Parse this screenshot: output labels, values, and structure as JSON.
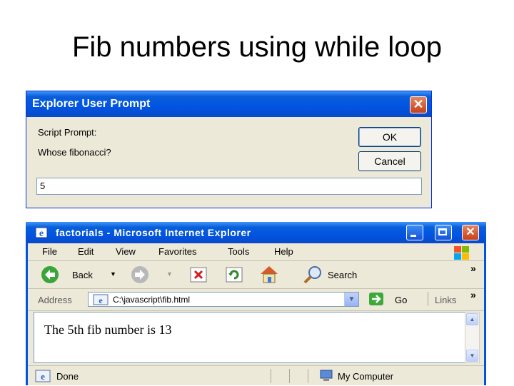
{
  "slide": {
    "title": "Fib numbers using while loop"
  },
  "prompt": {
    "title": "Explorer User Prompt",
    "label1": "Script Prompt:",
    "label2": "Whose fibonacci?",
    "ok_label": "OK",
    "cancel_label": "Cancel",
    "input_value": "5",
    "close_glyph": "✕"
  },
  "browser": {
    "title": "factorials - Microsoft Internet Explorer",
    "menu": [
      "File",
      "Edit",
      "View",
      "Favorites",
      "Tools",
      "Help"
    ],
    "toolbar": {
      "back_label": "Back",
      "search_label": "Search",
      "chevron": "»"
    },
    "address": {
      "label": "Address",
      "value": "C:\\javascript\\fib.html",
      "go_label": "Go",
      "links_label": "Links"
    },
    "content_text": "The 5th fib number is 13",
    "status": {
      "text": "Done",
      "zone": "My Computer"
    },
    "close_glyph": "✕"
  },
  "colors": {
    "xp_blue": "#0054e3",
    "dialog_bg": "#ece9d8",
    "close_red": "#c6411a"
  }
}
